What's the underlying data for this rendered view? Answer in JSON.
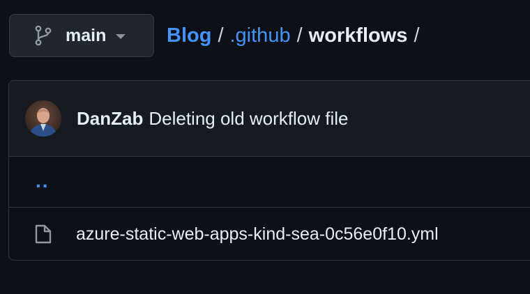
{
  "branch": {
    "name": "main",
    "icon": "git-branch-icon"
  },
  "breadcrumb": {
    "repo": "Blog",
    "folder": ".github",
    "current": "workflows",
    "separator": "/"
  },
  "latest_commit": {
    "author": "DanZab",
    "message": "Deleting old workflow file"
  },
  "files": {
    "parent_link": "..",
    "items": [
      {
        "name": "azure-static-web-apps-kind-sea-0c56e0f10.yml",
        "icon": "file-icon"
      }
    ]
  },
  "colors": {
    "background": "#0d1117",
    "link": "#4493f8",
    "text": "#e6edf3",
    "border": "#30363d"
  }
}
